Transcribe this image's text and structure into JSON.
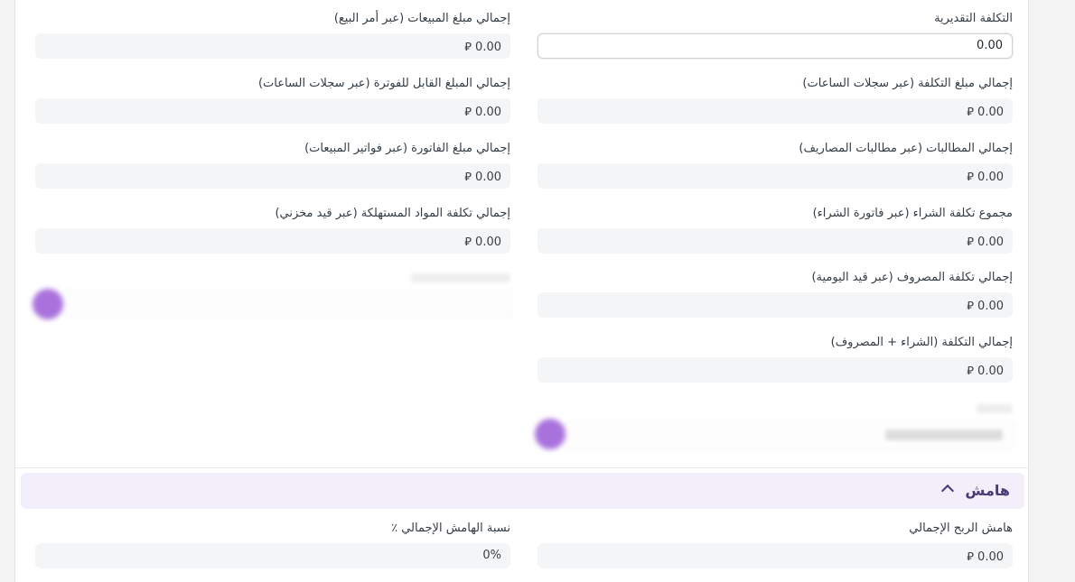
{
  "section_costing": {
    "right_column": [
      {
        "label": "التكلفة التقديرية",
        "value": "0.00",
        "editable": true
      },
      {
        "label": "إجمالي مبلغ التكلفة (عبر سجلات الساعات)",
        "value": "0.00 ⃁"
      },
      {
        "label": "إجمالي المطالبات (عبر مطالبات المصاريف)",
        "value": "0.00 ⃁"
      },
      {
        "label": "مجموع تكلفة الشراء (عبر فاتورة الشراء)",
        "value": "0.00 ⃁"
      },
      {
        "label": "إجمالي تكلفة المصروف (عبر قيد اليومية)",
        "value": "0.00 ⃁"
      },
      {
        "label": "إجمالي التكلفة (الشراء + المصروف)",
        "value": "0.00 ⃁"
      }
    ],
    "left_column": [
      {
        "label": "إجمالي مبلغ المبيعات (عبر أمر البيع)",
        "value": "0.00 ⃁"
      },
      {
        "label": "إجمالي المبلغ القابل للفوترة (عبر سجلات الساعات)",
        "value": "0.00 ⃁"
      },
      {
        "label": "إجمالي مبلغ الفاتورة (عبر فواتير المبيعات)",
        "value": "0.00 ⃁"
      },
      {
        "label": "إجمالي تكلفة المواد المستهلكة (عبر قيد مخزني)",
        "value": "0.00 ⃁"
      }
    ]
  },
  "section_margin": {
    "title": "هامش",
    "fields": [
      {
        "label": "هامش الربح الإجمالي",
        "value": "0.00 ⃁"
      },
      {
        "label": "نسبة الهامش الإجمالي ٪",
        "value": "0%"
      }
    ]
  },
  "colors": {
    "section_header_bg": "#f2effb",
    "section_title": "#4a3a74",
    "avatar": "#9b59d6",
    "readonly_field_bg": "#f4f5f6"
  }
}
